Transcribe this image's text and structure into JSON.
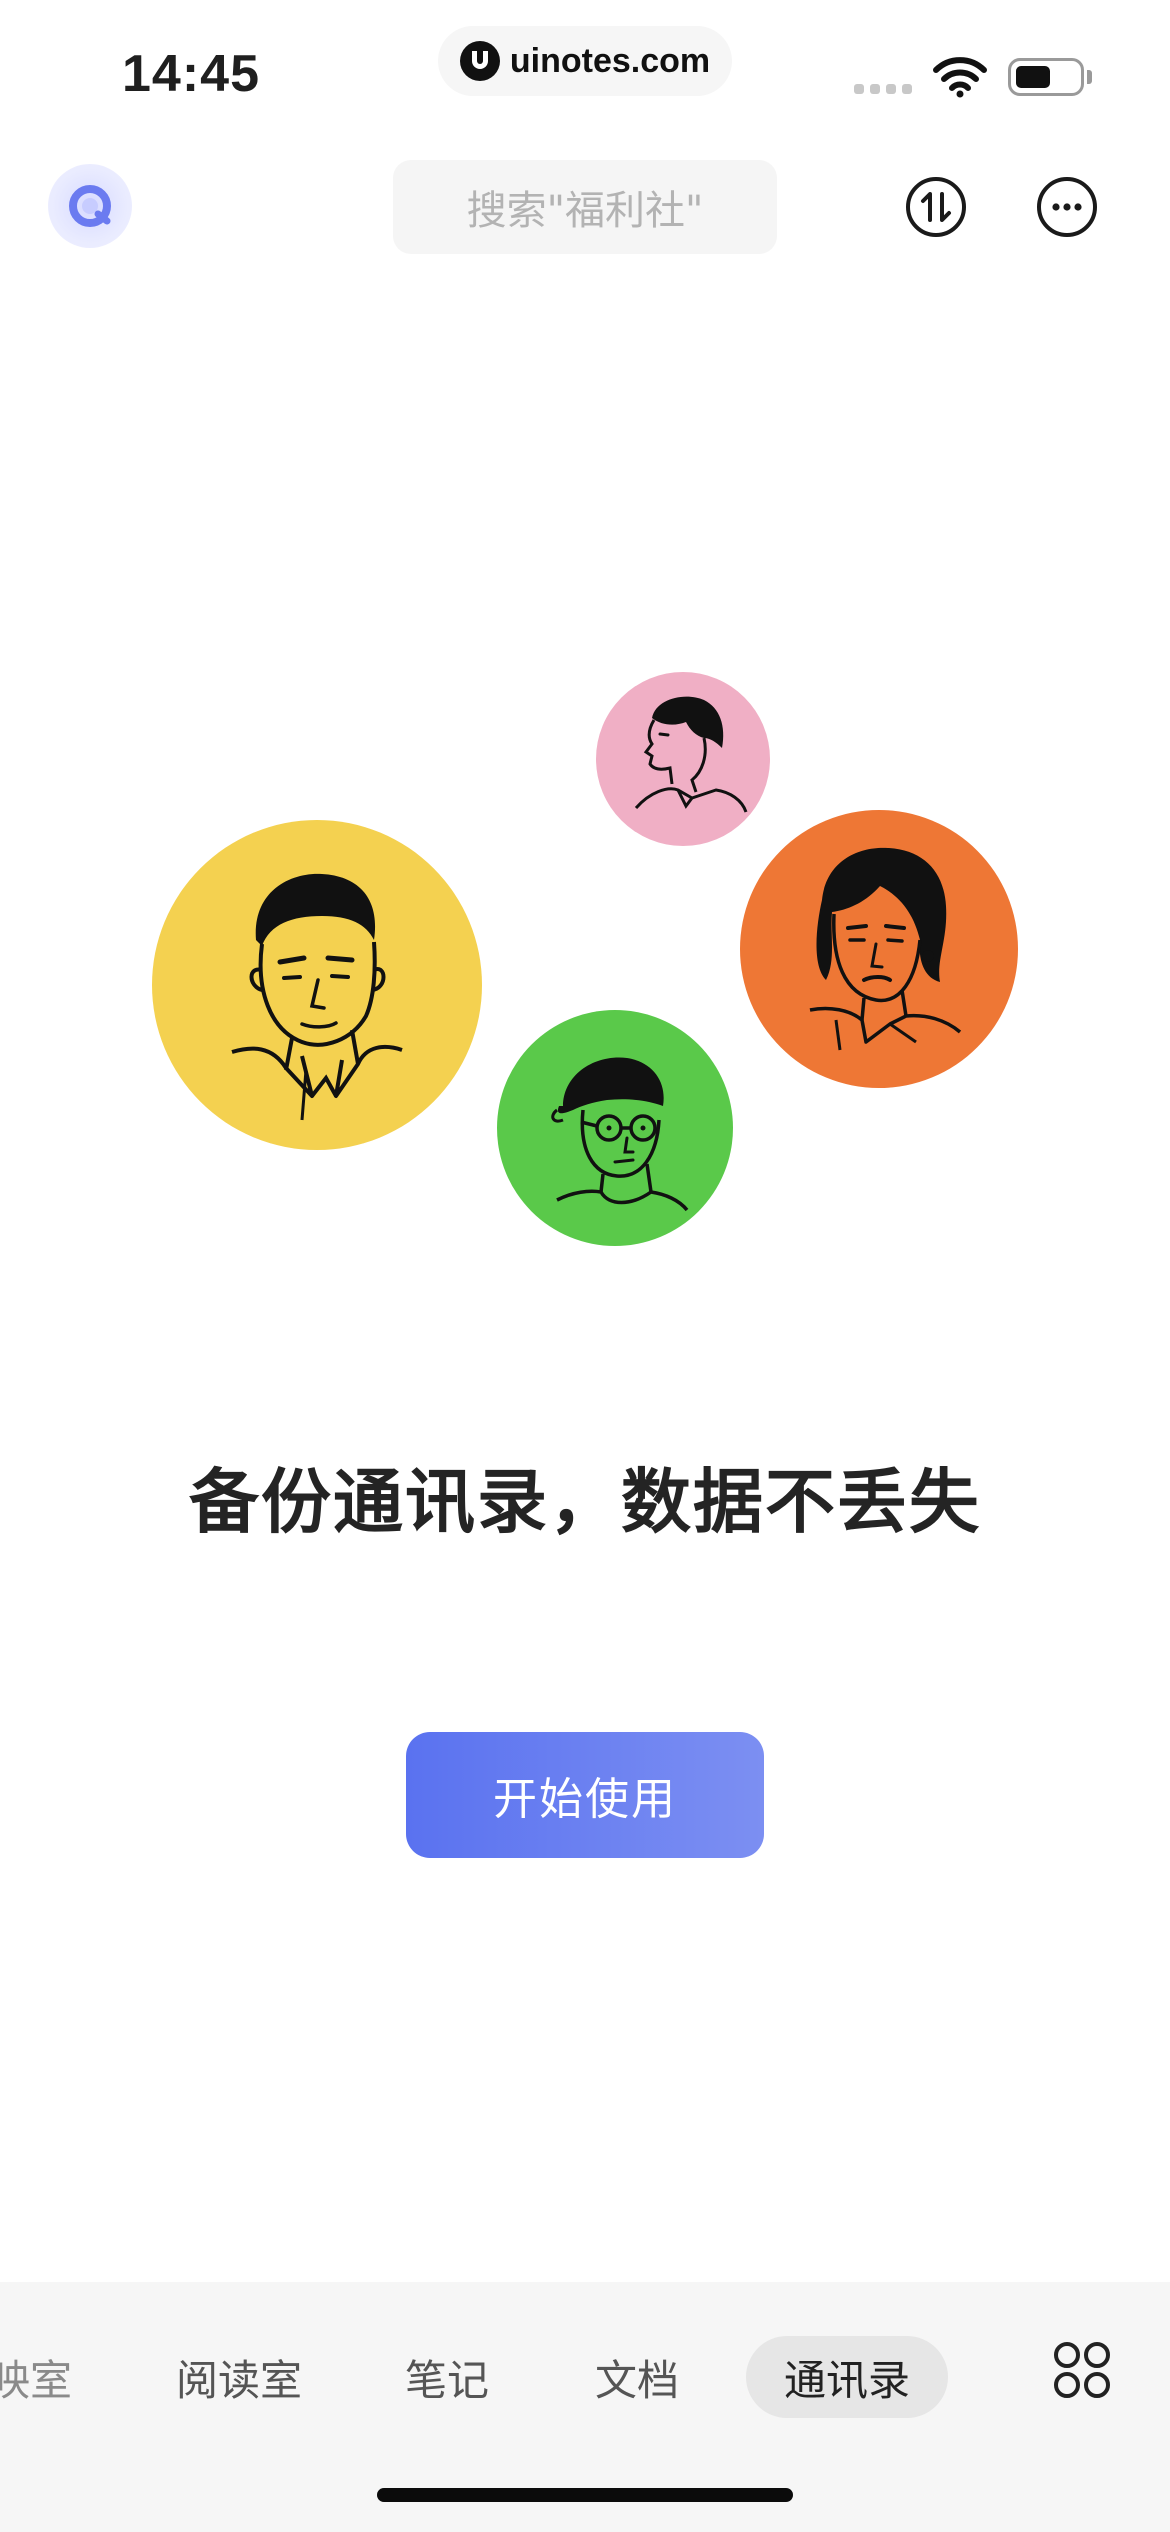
{
  "status_bar": {
    "time": "14:45",
    "url": "uinotes.com"
  },
  "header": {
    "search_placeholder": "搜索\"福利社\"",
    "accent_color": "#6b7bf0"
  },
  "illustration": {
    "colors": {
      "yellow": "#f4d150",
      "pink": "#f0afc5",
      "orange": "#ee7735",
      "green": "#5ac94a"
    }
  },
  "main": {
    "headline": "备份通讯录，数据不丢失",
    "cta_label": "开始使用"
  },
  "tabbar": {
    "tabs": [
      {
        "label": "映室",
        "partial": true
      },
      {
        "label": "阅读室"
      },
      {
        "label": "笔记"
      },
      {
        "label": "文档"
      },
      {
        "label": "通讯录",
        "active": true
      }
    ],
    "more_icon": "grid-icon"
  }
}
